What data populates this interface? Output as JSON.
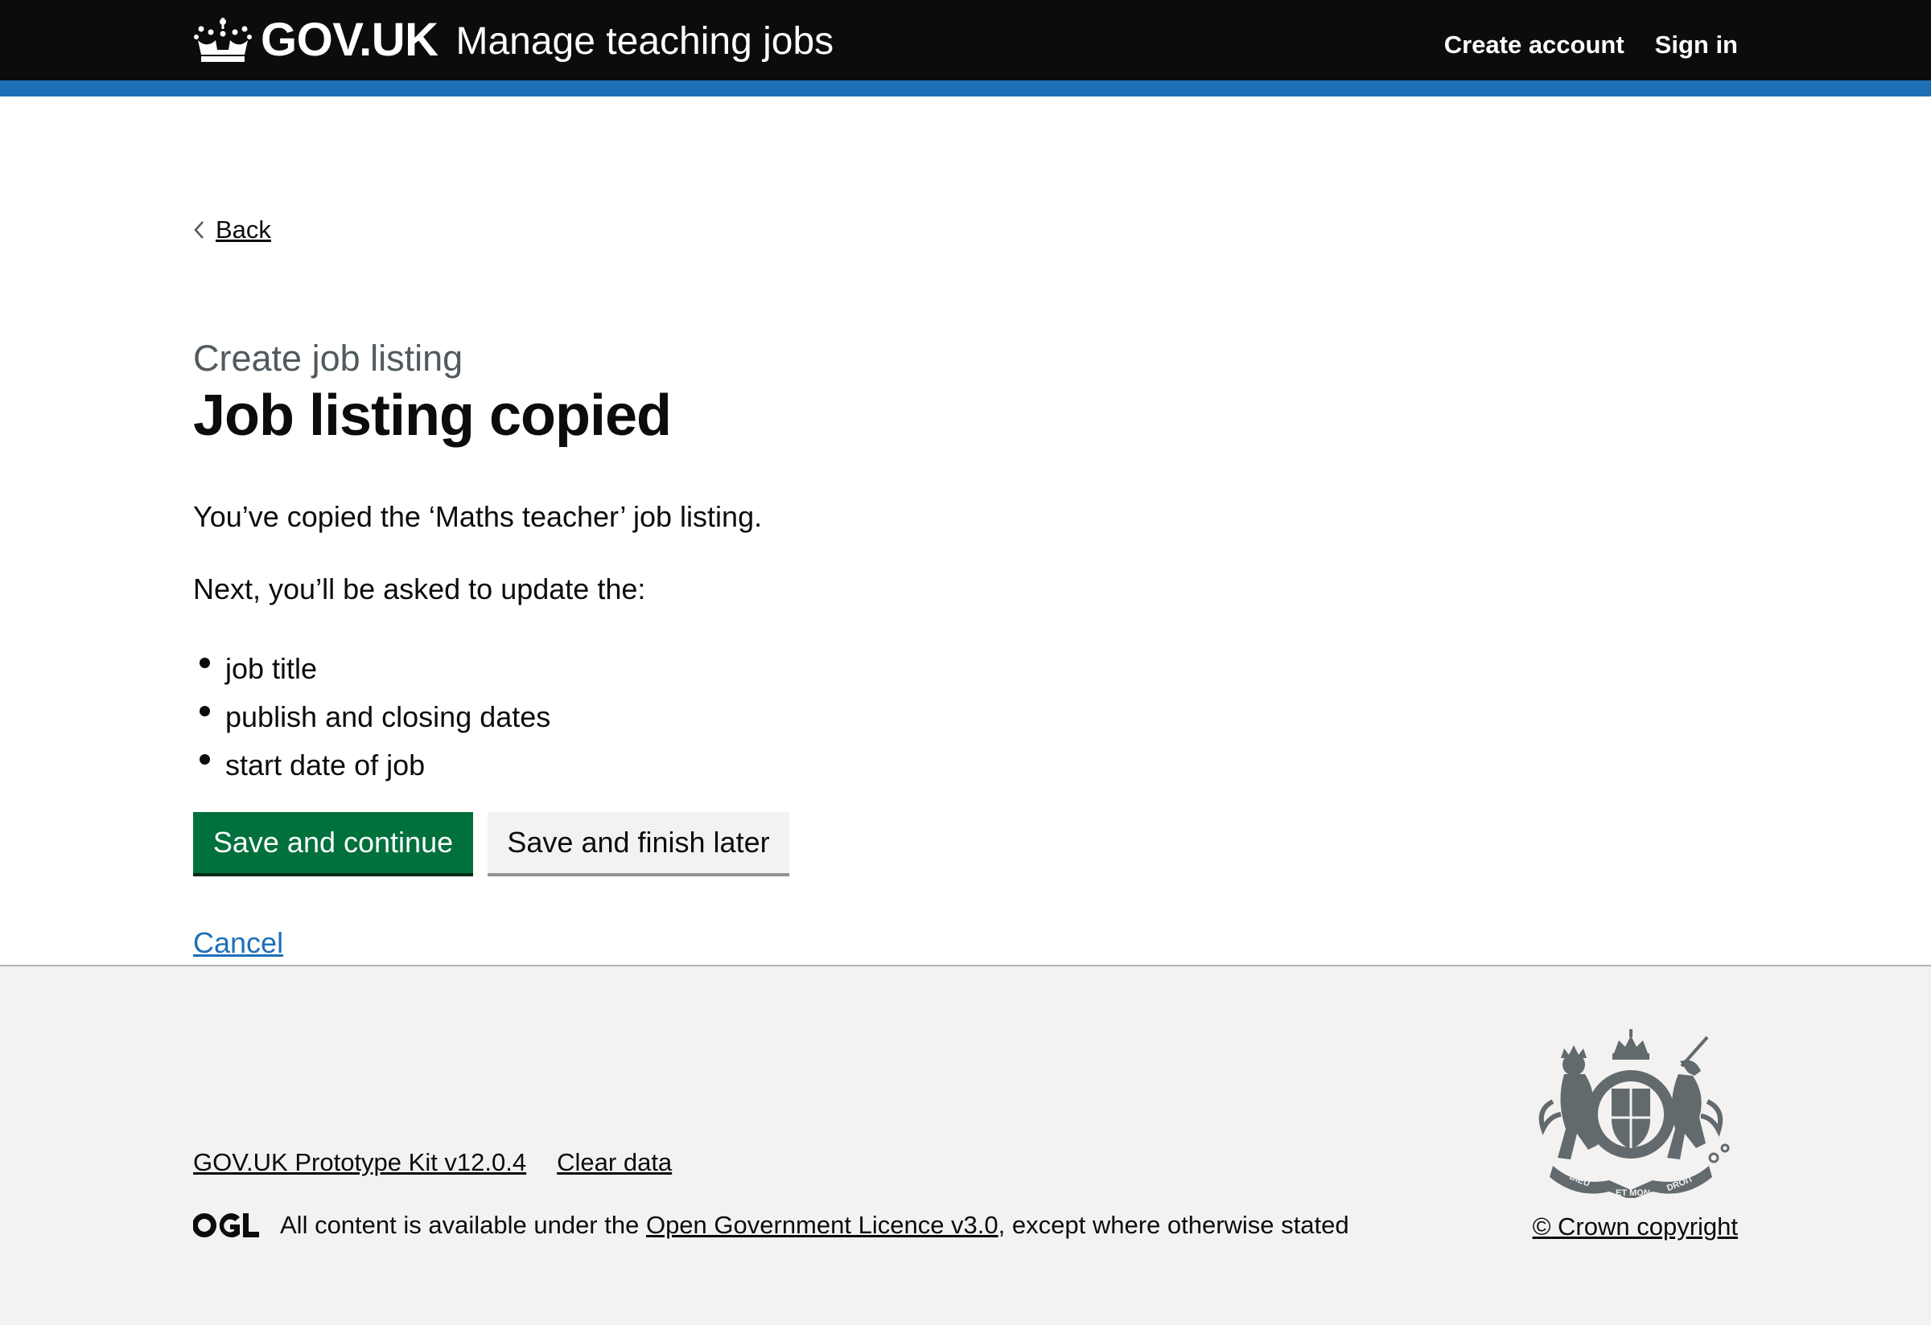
{
  "header": {
    "logo_text": "GOV.UK",
    "service_name": "Manage teaching jobs",
    "nav": [
      {
        "label": "Create account"
      },
      {
        "label": "Sign in"
      }
    ]
  },
  "back_link": {
    "label": "Back"
  },
  "page": {
    "caption": "Create job listing",
    "title": "Job listing copied",
    "intro": "You’ve copied the ‘Maths teacher’ job listing.",
    "next_text": "Next, you’ll be asked to update the:",
    "items": [
      "job title",
      "publish and closing dates",
      "start date of job"
    ],
    "primary_button": "Save and continue",
    "secondary_button": "Save and finish later",
    "cancel_link": "Cancel"
  },
  "footer": {
    "links": [
      {
        "label": "GOV.UK Prototype Kit v12.0.4"
      },
      {
        "label": "Clear data"
      }
    ],
    "licence_prefix": "All content is available under the ",
    "licence_link": "Open Government Licence v3.0",
    "licence_suffix": ", except where otherwise stated",
    "copyright": "© Crown copyright",
    "crest_motto_left": "DIEU",
    "crest_motto_mid": "ET MON",
    "crest_motto_right": "DROIT"
  },
  "colors": {
    "header_bg": "#0b0c0c",
    "header_stripe": "#1d70b8",
    "primary_button": "#00703c",
    "link": "#1d70b8",
    "footer_bg": "#f3f2f1",
    "caption": "#505a5f"
  },
  "icons": [
    "crown-icon",
    "chevron-left-icon",
    "ogl-logo",
    "royal-coat-of-arms"
  ]
}
